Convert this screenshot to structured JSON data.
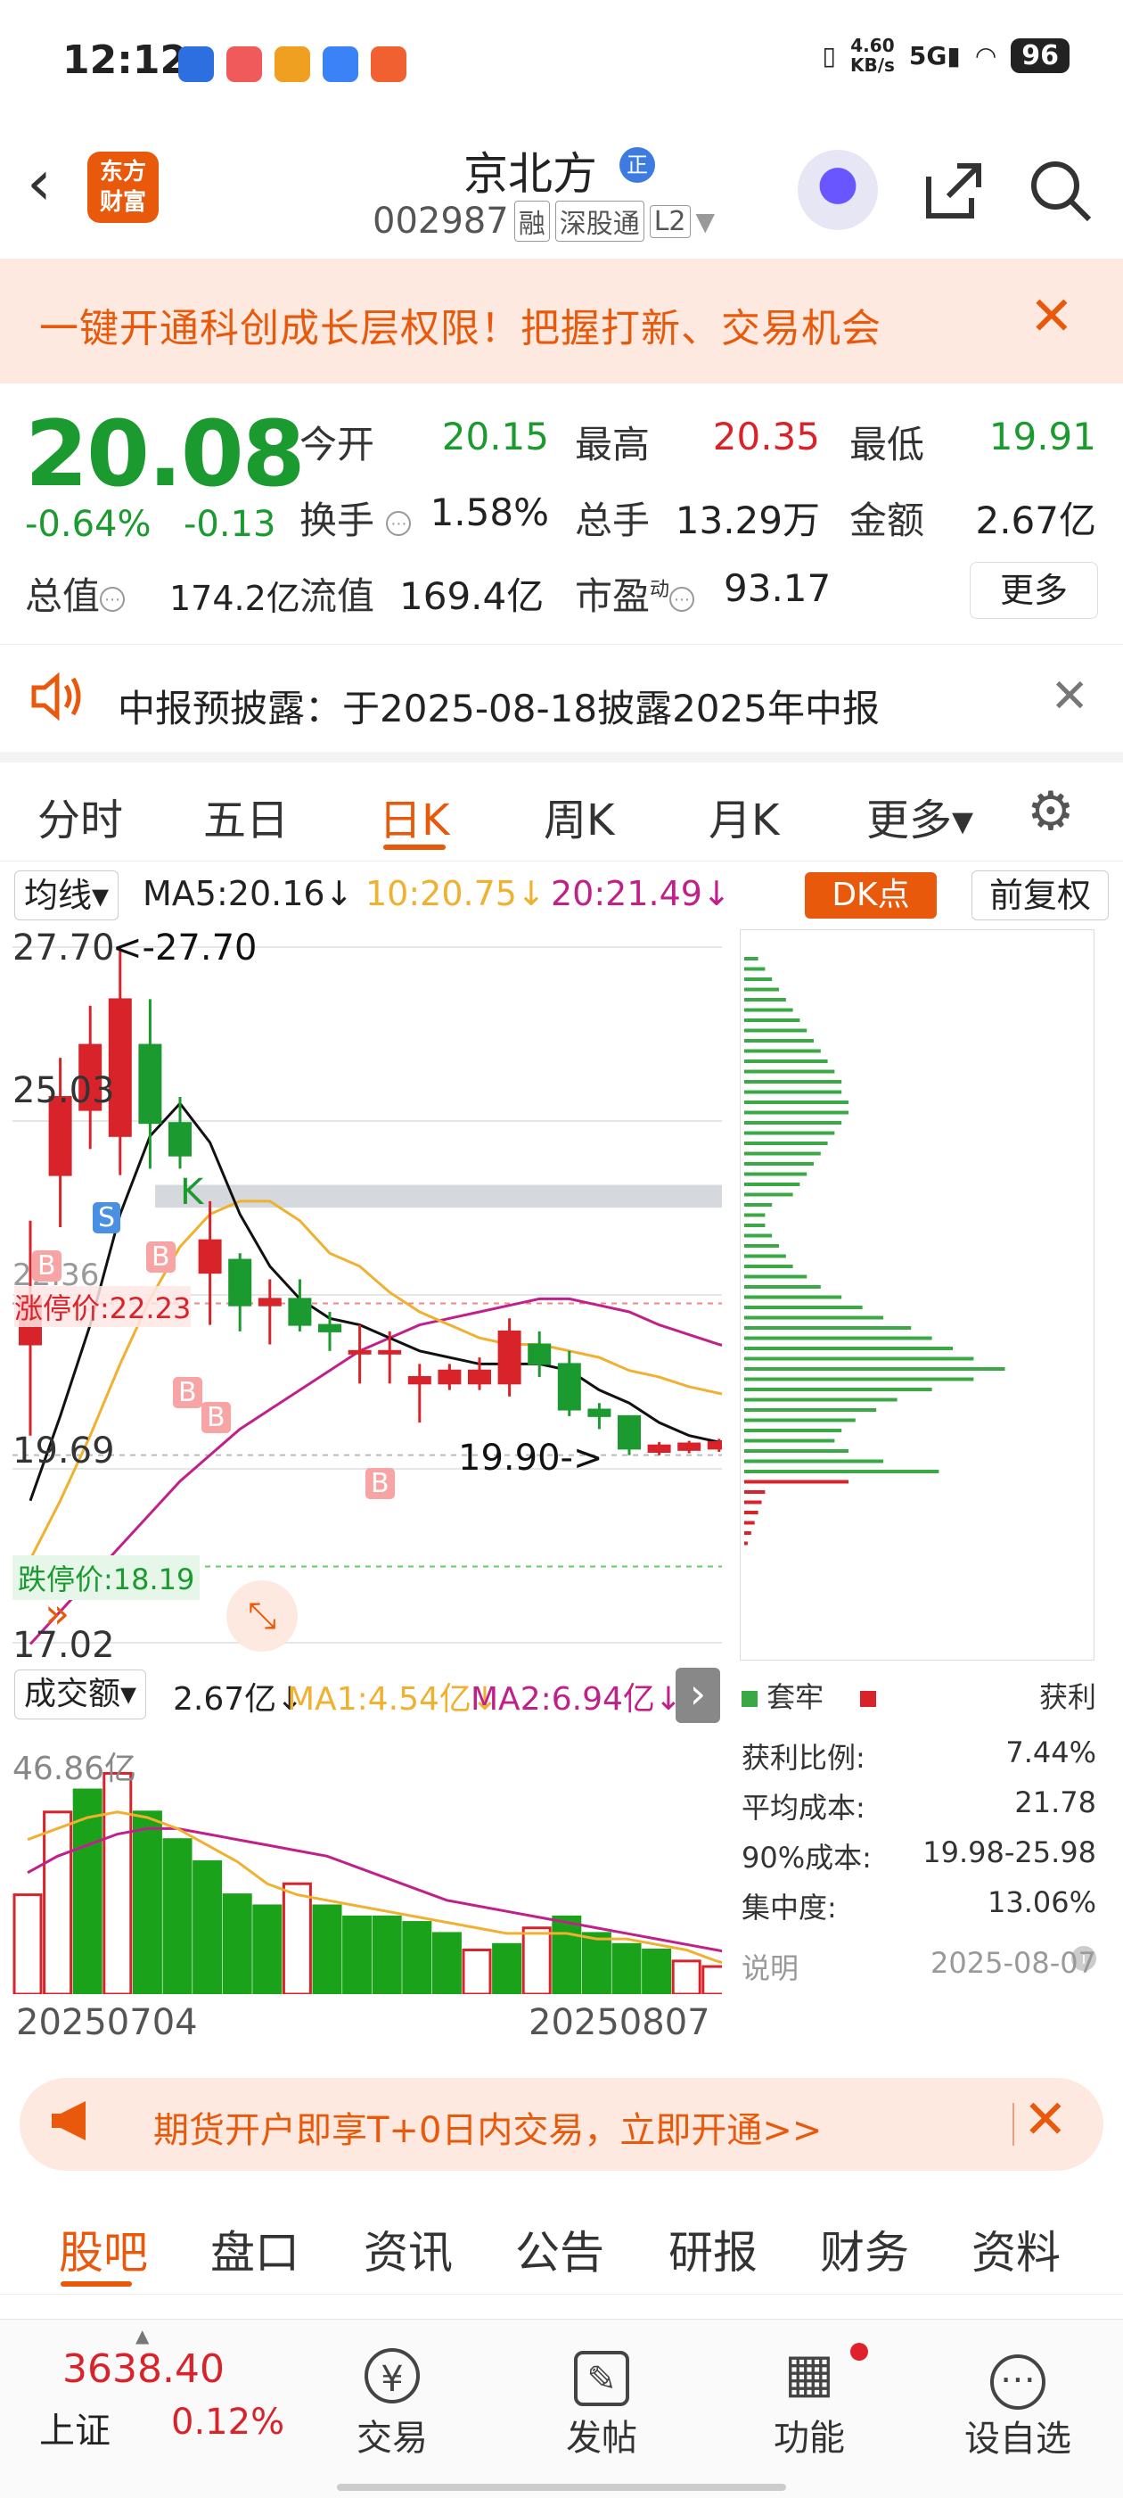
{
  "status": {
    "time": "12:12",
    "net_speed": "4.60\nKB/s",
    "net_speed_top": "4.60",
    "net_speed_unit": "KB/s",
    "signal": "5G",
    "battery": "96"
  },
  "header": {
    "back": "‹",
    "logo_top": "东方",
    "logo_bottom": "财富",
    "name": "京北方",
    "name_badge": "正",
    "code": "002987",
    "tags": [
      "融",
      "深股通",
      "L2"
    ]
  },
  "promo": {
    "text": "一键开通科创成长层权限！把握打新、交易机会",
    "close": "✕"
  },
  "quote": {
    "price": "20.08",
    "change_pct": "-0.64%",
    "change": "-0.13",
    "open_label": "今开",
    "open": "20.15",
    "high_label": "最高",
    "high": "20.35",
    "low_label": "最低",
    "low": "19.91",
    "turnover_label": "换手",
    "turnover": "1.58%",
    "volume_label": "总手",
    "volume": "13.29万",
    "amount_label": "金额",
    "amount": "2.67亿",
    "mcap_label": "总值",
    "mcap": "174.2亿",
    "float_label": "流值",
    "float": "169.4亿",
    "pe_label": "市盈",
    "pe_sup": "动",
    "pe": "93.17",
    "more": "更多"
  },
  "notice": {
    "text": "中报预披露：于2025-08-18披露2025年中报",
    "close": "✕"
  },
  "tabs": [
    "分时",
    "五日",
    "日K",
    "周K",
    "月K",
    "更多▾"
  ],
  "ma_row": {
    "selector": "均线▾",
    "ma5": "MA5:20.16↓",
    "ma10": "10:20.75↓",
    "ma20": "20:21.49↓",
    "dk": "DK点",
    "fq": "前复权"
  },
  "kchart_labels": {
    "y_top": "27.70",
    "y_mid": "25.03",
    "y_low": "19.69",
    "y_bottom": "17.02",
    "max_marker": "<-27.70",
    "min_marker": "19.90->",
    "limit_up": "涨停价:22.23",
    "limit_down": "跌停价:18.19",
    "y_mid2": "22.36",
    "k_mark": "K",
    "s_mark": "S",
    "b_mark": "B"
  },
  "colors": {
    "up": "#d8232a",
    "down": "#1a9a2f",
    "ma5": "#111111",
    "ma10": "#f0b030",
    "ma20": "#c0208a",
    "accent": "#e8590c"
  },
  "chart_data": {
    "type": "candlestick",
    "candles": [
      {
        "o": 21.6,
        "h": 23.5,
        "l": 20.2,
        "c": 22.3
      },
      {
        "o": 24.2,
        "h": 26.0,
        "l": 23.4,
        "c": 25.4
      },
      {
        "o": 25.2,
        "h": 26.8,
        "l": 24.6,
        "c": 26.2
      },
      {
        "o": 24.8,
        "h": 27.7,
        "l": 24.2,
        "c": 26.9
      },
      {
        "o": 26.2,
        "h": 26.9,
        "l": 24.3,
        "c": 25.0
      },
      {
        "o": 25.0,
        "h": 25.4,
        "l": 24.3,
        "c": 24.5
      },
      {
        "o": 22.7,
        "h": 23.8,
        "l": 21.9,
        "c": 23.2
      },
      {
        "o": 22.9,
        "h": 23.0,
        "l": 21.8,
        "c": 22.2
      },
      {
        "o": 22.2,
        "h": 22.6,
        "l": 21.6,
        "c": 22.3
      },
      {
        "o": 22.3,
        "h": 22.6,
        "l": 21.8,
        "c": 21.9
      },
      {
        "o": 21.9,
        "h": 22.1,
        "l": 21.5,
        "c": 21.8
      },
      {
        "o": 21.5,
        "h": 21.9,
        "l": 21.0,
        "c": 21.5
      },
      {
        "o": 21.5,
        "h": 21.8,
        "l": 21.0,
        "c": 21.5
      },
      {
        "o": 21.0,
        "h": 21.3,
        "l": 20.4,
        "c": 21.1
      },
      {
        "o": 21.0,
        "h": 21.3,
        "l": 20.9,
        "c": 21.2
      },
      {
        "o": 21.0,
        "h": 21.4,
        "l": 20.9,
        "c": 21.2
      },
      {
        "o": 21.0,
        "h": 22.0,
        "l": 20.8,
        "c": 21.8
      },
      {
        "o": 21.6,
        "h": 21.8,
        "l": 21.1,
        "c": 21.3
      },
      {
        "o": 21.3,
        "h": 21.5,
        "l": 20.5,
        "c": 20.6
      },
      {
        "o": 20.6,
        "h": 20.7,
        "l": 20.3,
        "c": 20.5
      },
      {
        "o": 20.5,
        "h": 20.5,
        "l": 19.9,
        "c": 20.0
      },
      {
        "o": 19.95,
        "h": 20.1,
        "l": 19.9,
        "c": 20.05
      },
      {
        "o": 19.98,
        "h": 20.12,
        "l": 19.93,
        "c": 20.08
      },
      {
        "o": 20.0,
        "h": 20.15,
        "l": 19.95,
        "c": 20.1
      },
      {
        "o": 20.15,
        "h": 20.35,
        "l": 19.91,
        "c": 20.08
      }
    ],
    "ma5": [
      19.2,
      20.5,
      21.9,
      23.6,
      24.8,
      25.3,
      24.7,
      23.6,
      22.8,
      22.3,
      22.0,
      21.9,
      21.7,
      21.5,
      21.4,
      21.3,
      21.3,
      21.3,
      21.2,
      20.9,
      20.7,
      20.4,
      20.2,
      20.1,
      20.16
    ],
    "ma10": [
      18.3,
      19.2,
      20.2,
      21.3,
      22.3,
      23.1,
      23.6,
      23.8,
      23.8,
      23.5,
      23.0,
      22.8,
      22.4,
      22.1,
      21.9,
      21.7,
      21.6,
      21.6,
      21.5,
      21.4,
      21.2,
      21.1,
      20.95,
      20.85,
      20.75
    ],
    "ma20": [
      17.0,
      17.5,
      18.0,
      18.5,
      19.0,
      19.5,
      19.9,
      20.3,
      20.6,
      20.9,
      21.2,
      21.5,
      21.7,
      21.9,
      22.0,
      22.1,
      22.2,
      22.3,
      22.3,
      22.2,
      22.1,
      21.9,
      21.75,
      21.6,
      21.49
    ],
    "ylim": [
      17.02,
      27.7
    ]
  },
  "chips_data": {
    "green_bars": [
      4,
      6,
      8,
      10,
      12,
      14,
      16,
      18,
      20,
      22,
      24,
      26,
      28,
      28,
      30,
      30,
      28,
      26,
      24,
      22,
      20,
      18,
      16,
      14,
      8,
      6,
      6,
      8,
      10,
      12,
      14,
      18,
      22,
      28,
      34,
      40,
      48,
      54,
      60,
      66,
      75,
      66,
      54,
      44,
      38,
      32,
      28,
      26,
      30,
      40,
      56
    ],
    "red_bars": [
      30,
      6,
      5,
      4,
      3,
      2,
      1
    ]
  },
  "vol_row": {
    "selector": "成交额▾",
    "value": "2.67亿↓",
    "ma1": "MA1:4.54亿↓",
    "ma2": "MA2:6.94亿↓",
    "arrow": "›",
    "y_top": "46.86亿"
  },
  "vol_data": {
    "values": [
      18,
      33,
      37,
      40,
      33,
      28,
      24,
      18,
      16,
      20,
      16,
      14,
      14,
      13,
      11,
      8,
      9,
      12,
      14,
      11,
      9,
      8,
      6,
      5,
      4.3
    ],
    "up": [
      true,
      true,
      false,
      true,
      false,
      false,
      false,
      false,
      false,
      true,
      false,
      false,
      false,
      false,
      false,
      true,
      false,
      true,
      false,
      false,
      false,
      false,
      true,
      true,
      false
    ],
    "ma1": [
      28,
      30,
      32,
      33,
      32,
      30,
      27,
      24,
      20,
      18,
      17,
      16,
      15,
      14,
      13,
      12,
      11,
      11,
      11,
      10,
      10,
      9,
      8,
      6,
      4.5
    ],
    "ma2": [
      22,
      25,
      27,
      29,
      30,
      30,
      29,
      28,
      27,
      26,
      25,
      23,
      21,
      19,
      17,
      16,
      15,
      14,
      13,
      12,
      11,
      10,
      9,
      8,
      7
    ]
  },
  "dates": {
    "start": "20250704",
    "end": "20250807"
  },
  "chip_info": {
    "legend_loss": "套牢",
    "legend_profit": "获利",
    "rows": [
      [
        "获利比例:",
        "7.44%"
      ],
      [
        "平均成本:",
        "21.78"
      ],
      [
        "90%成本:",
        "19.98-25.98"
      ],
      [
        "集中度:",
        "13.06%"
      ]
    ],
    "note": "说明",
    "date": "2025-08-07"
  },
  "futures": {
    "text": "期货开户即享T+0日内交易，立即开通>>",
    "close": "✕"
  },
  "sections": [
    "股吧",
    "盘口",
    "资讯",
    "公告",
    "研报",
    "财务",
    "资料"
  ],
  "nav": {
    "index_value": "3638.40",
    "index_name": "上证",
    "index_pct": "0.12%",
    "items": [
      {
        "icon": "¥",
        "label": "交易"
      },
      {
        "icon": "✎",
        "label": "发帖"
      },
      {
        "icon": "▦",
        "label": "功能"
      },
      {
        "icon": "⋯",
        "label": "设自选"
      }
    ]
  }
}
